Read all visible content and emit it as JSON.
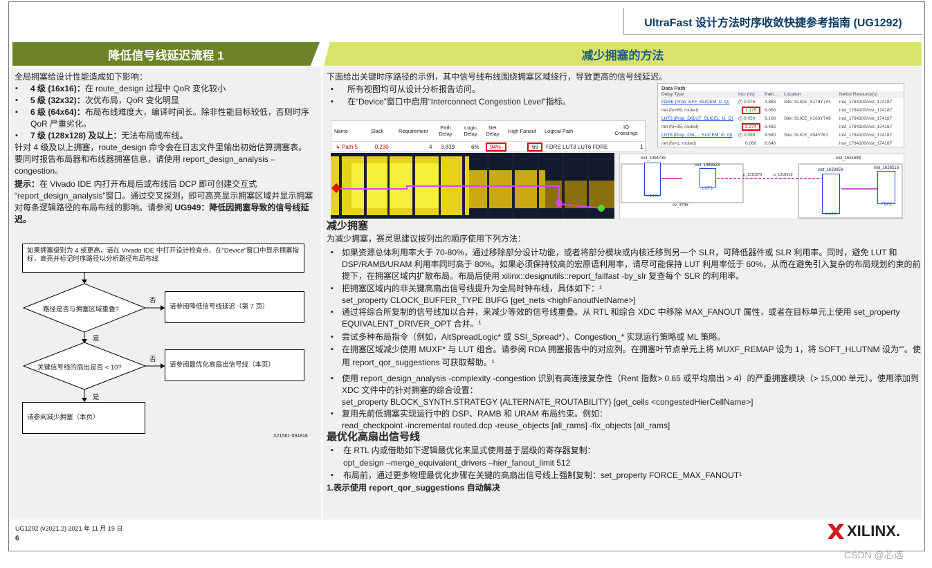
{
  "header": {
    "title": "UltraFast 设计方法时序收敛快捷参考指南 (UG1292)"
  },
  "left": {
    "banner": "降低信号线延迟流程 1",
    "intro": "全局拥塞给设计性能造成如下影响：",
    "levels": [
      {
        "label": "4 级 (16x16)：",
        "text": "在 route_design 过程中 QoR 变化较小"
      },
      {
        "label": "5 级 (32x32)：",
        "text": "次优布局，QoR 变化明显"
      },
      {
        "label": "6 级 (64x64)：",
        "text": "布局布线难度大，编译时间长。除非性能目标较低，否则时序"
      },
      {
        "label": "",
        "text": "QoR 严重劣化。"
      },
      {
        "label": "7 级 (128x128) 及以上：",
        "text": "无法布局或布线。"
      }
    ],
    "para1": [
      "针对 4 级及以上拥塞，route_design 命令会在日志文件里输出初始估算拥塞表。",
      "要同时报告布局器和布线器拥塞信息，请使用 report_design_analysis –",
      "congestion。"
    ],
    "tip_label": "提示：",
    "tip": [
      "在 Vivado IDE 内打开布局后或布线后 DCP 即可创建交互式",
      "“report_design_analysis”窗口。通过交叉探测，即可高亮显示拥塞区域并显示拥塞",
      "对每条逻辑路径的布局布线的影响。请参阅 "
    ],
    "tip_ref": "UG949：降低因拥塞导致的信号线延",
    "tip_ref2": "迟。",
    "flow": {
      "box1": "如果拥塞级别为 4 或更高，请在 Vivado IDE 中打开设计检查点、在“Device”窗口中显示拥塞指标，高亮并标记时序路径以分析路径布局布线",
      "q1": "路径是否与拥塞区域重叠?",
      "no1": "否",
      "a1": "请参阅降低信号线延迟（第 7 页）",
      "yes1": "是",
      "q2": "关键信号线的扇出是否 < 10?",
      "no2": "否",
      "a2": "请参阅最优化高扇出信号线（本页）",
      "yes2": "是",
      "a3": "请参阅减少拥塞（本页）",
      "fig_id": "X21581-091818"
    }
  },
  "right": {
    "banner": "减少拥塞的方法",
    "intro": "下面给出关键时序路径的示例，其中信号线布线围绕拥塞区域绕行，导致更高的信号线延迟。",
    "b1": "所有视图均可从设计分析报告访问。",
    "b2": "在“Device”窗口中启用“Interconnect Congestion Level”指标。",
    "path_table": {
      "headers": [
        "Name",
        "Slack",
        "Requirement",
        "Path Delay",
        "Logic Delay",
        "Net Delay",
        "High Fanout",
        "Logical Path",
        "IO Crossings"
      ],
      "row": [
        "Path 5",
        "-0.230",
        "4",
        "3.839",
        "6%",
        "94%",
        "69",
        "FDRE LUT3 LUT6 FDRE",
        "1"
      ]
    },
    "data_path": {
      "title": "Data Path",
      "headers": [
        "Delay Type",
        "Incr (ns)",
        "Path...",
        "Location",
        "Netlist Resource(s)"
      ],
      "rows": [
        [
          "FDRE (Prop_EFF_SLICEM_C_Q)",
          "(f) 0.076",
          "4.883",
          "Site: SLICE_X179Y744",
          "inst_1784100/inst_174187"
        ],
        [
          "net (fo=69, routed)",
          "1.175",
          "6.058",
          "",
          "inst_1784100/inst_174187"
        ],
        [
          "LUT3 (Prop_D6LUT_SLICEL_I1_O)",
          "(f) 0.050",
          "6.108",
          "Site: SLICE_X163Y749",
          "inst_1784100/inst_174187"
        ],
        [
          "net (fo=35, routed)",
          "2.374",
          "8.482",
          "",
          "inst_1784100/inst_174187"
        ],
        [
          "LUT6 (Prop_C6L..._SLICEM_I0_O)",
          "(f) 0.098",
          "8.580",
          "Site: SLICE_X94Y761",
          "inst_1784100/inst_174187"
        ],
        [
          "net (fo=1, routed)",
          "0.066",
          "8.646",
          "",
          "inst_1784100/inst_174187"
        ]
      ]
    },
    "schematic": {
      "c1": "inst_1494735",
      "c2": "inst_1489523",
      "c3": "inst_1631698",
      "c4": "inst_1629059",
      "c5": "inst_1626516",
      "n1": "p_1310279",
      "n2": "p_1318919",
      "l1": "FDRE",
      "l2": "LUT3",
      "l3": "LUT6",
      "l4": "FDRE",
      "cv": "cv_3735"
    },
    "sec1": "减少拥塞",
    "sec1_intro": "为减少拥塞，赛灵思建议按列出的顺序使用下列方法：",
    "items": [
      [
        "如果资源总体利用率大于 70-80%，通过移除部分设计功能，或者将部分模块或内核迁移到另一个 SLR，可降低器件或 SLR 利用率。同时，避免 LUT 和",
        "DSP/RAMB/URAM 利用率同时高于 80%。如果必须保持较高的宏原语利用率，请尽可能保持 LUT 利用率低于 60%，从而在避免引入复杂的布局规划约束的前",
        "提下，在拥塞区域内扩散布局。布局后使用 xilinx::designutils::report_failfast -by_slr 复查每个 SLR 的利用率。"
      ],
      [
        "把拥塞区域内的非关键高扇出信号线提升为全局时钟布线，具体如下：¹",
        "set_property CLOCK_BUFFER_TYPE BUFG [get_nets <highFanoutNetName>]"
      ],
      [
        "通过将综合所复制的信号线加以合并，来减少等效的信号线重叠。从 RTL 和综合 XDC 中移除 MAX_FANOUT 属性，或者在目标单元上使用 set_property",
        "EQUIVALENT_DRIVER_OPT 合并。¹"
      ],
      [
        "尝试多种布局指令（例如，AltSpreadLogic* 或 SSI_Spread*）、Congestion_* 实现运行策略或 ML 策略。"
      ],
      [
        "在拥塞区域减少使用 MUXF* 与 LUT 组合。请参阅 RDA 拥塞报告中的对应列。在拥塞叶节点单元上将 MUXF_REMAP 设为 1，将 SOFT_HLUTNM 设为“”。使",
        "用 report_qor_suggestions 可获取帮助。¹"
      ],
      [
        "使用 report_design_analysis -complexity -congestion 识别有高连接复杂性（Rent 指数> 0.65 或平均扇出 > 4）的严重拥塞模块（> 15,000 单元）。使用添加到",
        "XDC 文件中的针对拥塞的综合设置：",
        "set_property BLOCK_SYNTH.STRATEGY {ALTERNATE_ROUTABILITY} [get_cells <congestedHierCellName>]"
      ],
      [
        "复用先前低拥塞实现运行中的 DSP、RAMB 和 URAM 布局约束。例如：",
        "read_checkpoint -incremental routed.dcp -reuse_objects [all_rams] -fix_objects [all_rams]"
      ]
    ],
    "sec2": "最优化高扇出信号线",
    "items2": [
      [
        "在 RTL 内或借助如下逻辑最优化来显式使用基于层级的寄存器复制：",
        "opt_design –merge_equivalent_drivers –hier_fanout_limit 512"
      ],
      [
        "布局前，通过更多物理最优化步骤在关键的高扇出信号线上强制复制：set_property FORCE_MAX_FANOUT¹"
      ]
    ],
    "footnote_num": "1.",
    "footnote": "表示使用 report_qor_suggestions 自动解决"
  },
  "footer": {
    "doc_id": "UG1292 (v2021.2) 2021 年 11 月 19 日",
    "page": "6",
    "logo": "XILINX.",
    "watermark": "CSDN @芯选"
  }
}
